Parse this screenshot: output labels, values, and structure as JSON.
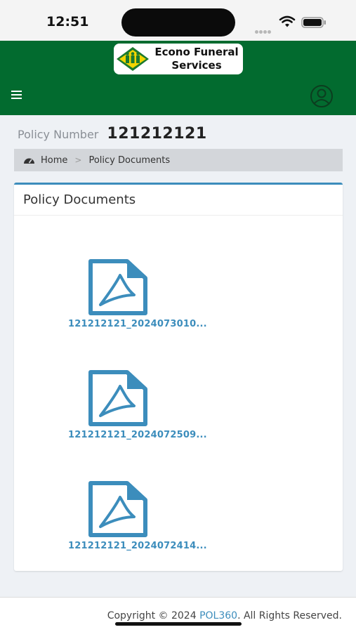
{
  "status_bar": {
    "time": "12:51"
  },
  "header": {
    "logo_line1": "Econo Funeral",
    "logo_line2": "Services",
    "menu_icon": "hamburger-menu-icon",
    "user_icon": "user-avatar-icon",
    "brand_color": "#026b2f"
  },
  "policy": {
    "label": "Policy Number",
    "number": "121212121"
  },
  "breadcrumb": {
    "home": "Home",
    "separator": ">",
    "current": "Policy Documents"
  },
  "panel": {
    "title": "Policy Documents",
    "accent_color": "#3c8dbc",
    "documents": [
      {
        "name": "121212121_2024073010...",
        "icon": "pdf-file-icon"
      },
      {
        "name": "121212121_2024072509...",
        "icon": "pdf-file-icon"
      },
      {
        "name": "121212121_2024072414...",
        "icon": "pdf-file-icon"
      }
    ]
  },
  "footer": {
    "prefix": "Copyright © 2024 ",
    "link": "POL360",
    "suffix": ". All Rights Reserved."
  }
}
